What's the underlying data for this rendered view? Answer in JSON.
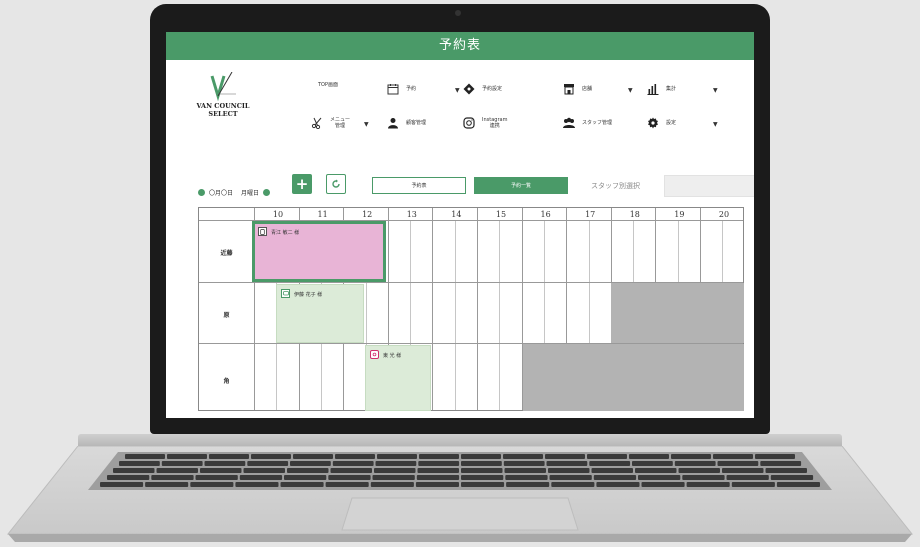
{
  "app": {
    "title": "予約表"
  },
  "logo": {
    "name": "VAN COUNCIL\nSELECT"
  },
  "menu": [
    {
      "id": "top",
      "label": "TOP画面",
      "icon": "home-icon",
      "caret": false
    },
    {
      "id": "reserve",
      "label": "予約",
      "icon": "calendar-icon",
      "caret": true
    },
    {
      "id": "reserve-settings",
      "label": "予約設定",
      "icon": "tag-icon",
      "caret": false
    },
    {
      "id": "store",
      "label": "店舗",
      "icon": "store-icon",
      "caret": true
    },
    {
      "id": "stats",
      "label": "集計",
      "icon": "bar-chart-icon",
      "caret": true
    },
    {
      "id": "menu-mgmt",
      "label": "メニュー\n管理",
      "icon": "scissors-icon",
      "caret": true
    },
    {
      "id": "customer",
      "label": "顧客管理",
      "icon": "user-icon",
      "caret": false
    },
    {
      "id": "instagram",
      "label": "Instagram\n連携",
      "icon": "instagram-icon",
      "caret": false
    },
    {
      "id": "staff",
      "label": "スタッフ管理",
      "icon": "staff-icon",
      "caret": false
    },
    {
      "id": "settings",
      "label": "設定",
      "icon": "gear-icon",
      "caret": true
    }
  ],
  "toolbar": {
    "date_text": "〇月〇日",
    "weekday_text": "月曜日",
    "add_icon": "plus-icon",
    "refresh_icon": "refresh-icon",
    "tab_table": "予約表",
    "tab_list": "予約一覧",
    "staff_label": "スタッフ別選択",
    "staff_value": ""
  },
  "schedule": {
    "hours": [
      "10",
      "11",
      "12",
      "13",
      "14",
      "15",
      "16",
      "17",
      "18",
      "19",
      "20"
    ],
    "staff": [
      "近藤",
      "原",
      "角"
    ],
    "bookings": [
      {
        "staff": "近藤",
        "name": "青江 敏二 様",
        "icon": "phone-icon",
        "color": "#e8b4d6",
        "selected": true
      },
      {
        "staff": "原",
        "name": "伊藤 花子 様",
        "icon": "line-chat-icon",
        "color": "#dcebd8",
        "selected": false
      },
      {
        "staff": "角",
        "name": "東 光 様",
        "icon": "instagram-icon",
        "color": "#dcebd8",
        "selected": false
      }
    ]
  },
  "colors": {
    "brand": "#4a9a68",
    "booking_pink": "#e8b4d6",
    "booking_green": "#dcebd8",
    "unavailable": "#b3b3b3"
  }
}
